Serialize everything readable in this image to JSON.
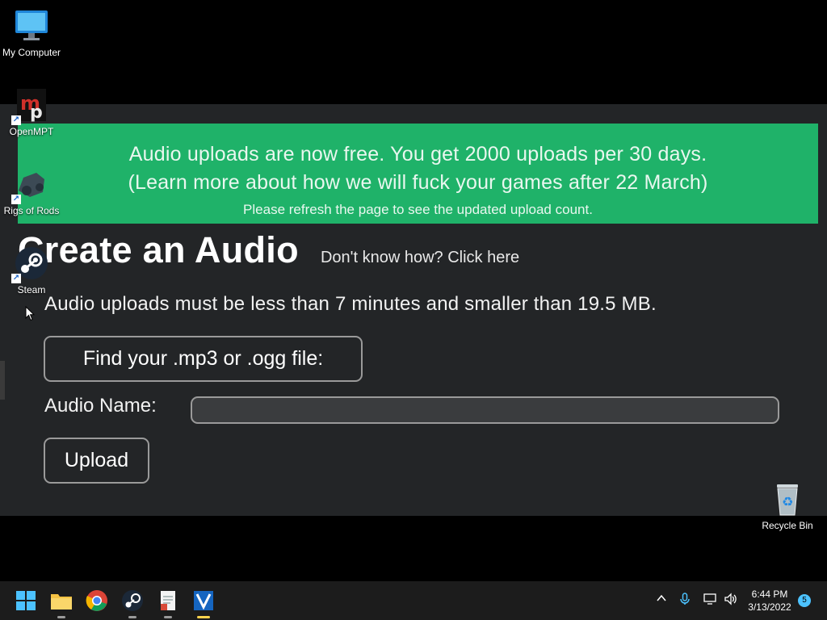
{
  "desktop": {
    "icons": [
      {
        "label": "My Computer",
        "icon": "monitor-icon"
      },
      {
        "label": "OpenMPT",
        "icon": "openmpt-icon"
      },
      {
        "label": "Rigs of Rods",
        "icon": "rigs-of-rods-icon"
      },
      {
        "label": "Steam",
        "icon": "steam-icon"
      },
      {
        "label": "Recycle Bin",
        "icon": "recycle-bin-icon"
      }
    ]
  },
  "banner": {
    "line1": "Audio uploads are now free. You get 2000 uploads per 30 days.",
    "line2": "(Learn more about how we will fuck your games after 22 March)",
    "note": "Please refresh the page to see the updated upload count.",
    "color": "#1fb269"
  },
  "page": {
    "title": "Create an Audio",
    "help_link": "Don't know how? Click here",
    "limits": "Audio uploads must be less than 7 minutes and smaller than 19.5 MB.",
    "find_file_button": "Find your .mp3 or .ogg file:",
    "name_label": "Audio Name:",
    "name_value": "",
    "upload_button": "Upload"
  },
  "taskbar": {
    "apps": [
      "windows-start-icon",
      "file-explorer-icon",
      "chrome-icon",
      "steam-icon",
      "notepad-icon",
      "video-editor-icon"
    ],
    "time": "6:44 PM",
    "date": "3/13/2022",
    "notification_count": "5",
    "accent": "#fcd34d"
  }
}
